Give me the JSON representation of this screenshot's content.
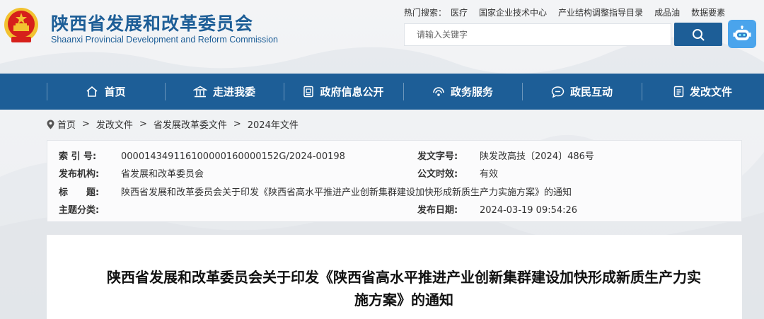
{
  "header": {
    "title": "陕西省发展和改革委员会",
    "subtitle": "Shaanxi Provincial Development and Reform Commission",
    "hot_label": "热门搜索：",
    "hot_links": [
      "医疗",
      "国家企业技术中心",
      "产业结构调整指导目录",
      "成品油",
      "数据要素"
    ],
    "search_placeholder": "请输入关键字",
    "search_icon": "search-icon",
    "robot_icon": "robot-icon"
  },
  "nav": {
    "items": [
      {
        "label": "首页",
        "icon": "home-icon"
      },
      {
        "label": "走进我委",
        "icon": "building-icon"
      },
      {
        "label": "政府信息公开",
        "icon": "document-icon"
      },
      {
        "label": "政务服务",
        "icon": "signal-icon"
      },
      {
        "label": "政民互动",
        "icon": "chat-icon"
      },
      {
        "label": "发改文件",
        "icon": "file-icon"
      }
    ]
  },
  "breadcrumb": {
    "items": [
      "首页",
      "发改文件",
      "省发展改革委文件",
      "2024年文件"
    ],
    "separator": ">"
  },
  "meta": {
    "index_label": "索 引 号:",
    "index_value": "000014349116100000160000152G/2024-00198",
    "doc_no_label": "发文字号:",
    "doc_no_value": "陕发改高技〔2024〕486号",
    "issuer_label": "发布机构:",
    "issuer_value": "省发展和改革委员会",
    "validity_label": "公文时效:",
    "validity_value": "有效",
    "title_label": "标　　题:",
    "title_value": "陕西省发展和改革委员会关于印发《陕西省高水平推进产业创新集群建设加快形成新质生产力实施方案》的通知",
    "category_label": "主题分类:",
    "category_value": "",
    "date_label": "发布日期:",
    "date_value": "2024-03-19 09:54:26"
  },
  "content": {
    "title_line1": "陕西省发展和改革委员会关于印发《陕西省高水平推进产业创新集群建设加快形成新质生产力实",
    "title_line2": "施方案》的通知"
  },
  "colors": {
    "brand_blue": "#1d5e97",
    "robot_blue": "#4aa4ec",
    "emblem_red": "#d6201b",
    "emblem_gold": "#f2c230"
  }
}
